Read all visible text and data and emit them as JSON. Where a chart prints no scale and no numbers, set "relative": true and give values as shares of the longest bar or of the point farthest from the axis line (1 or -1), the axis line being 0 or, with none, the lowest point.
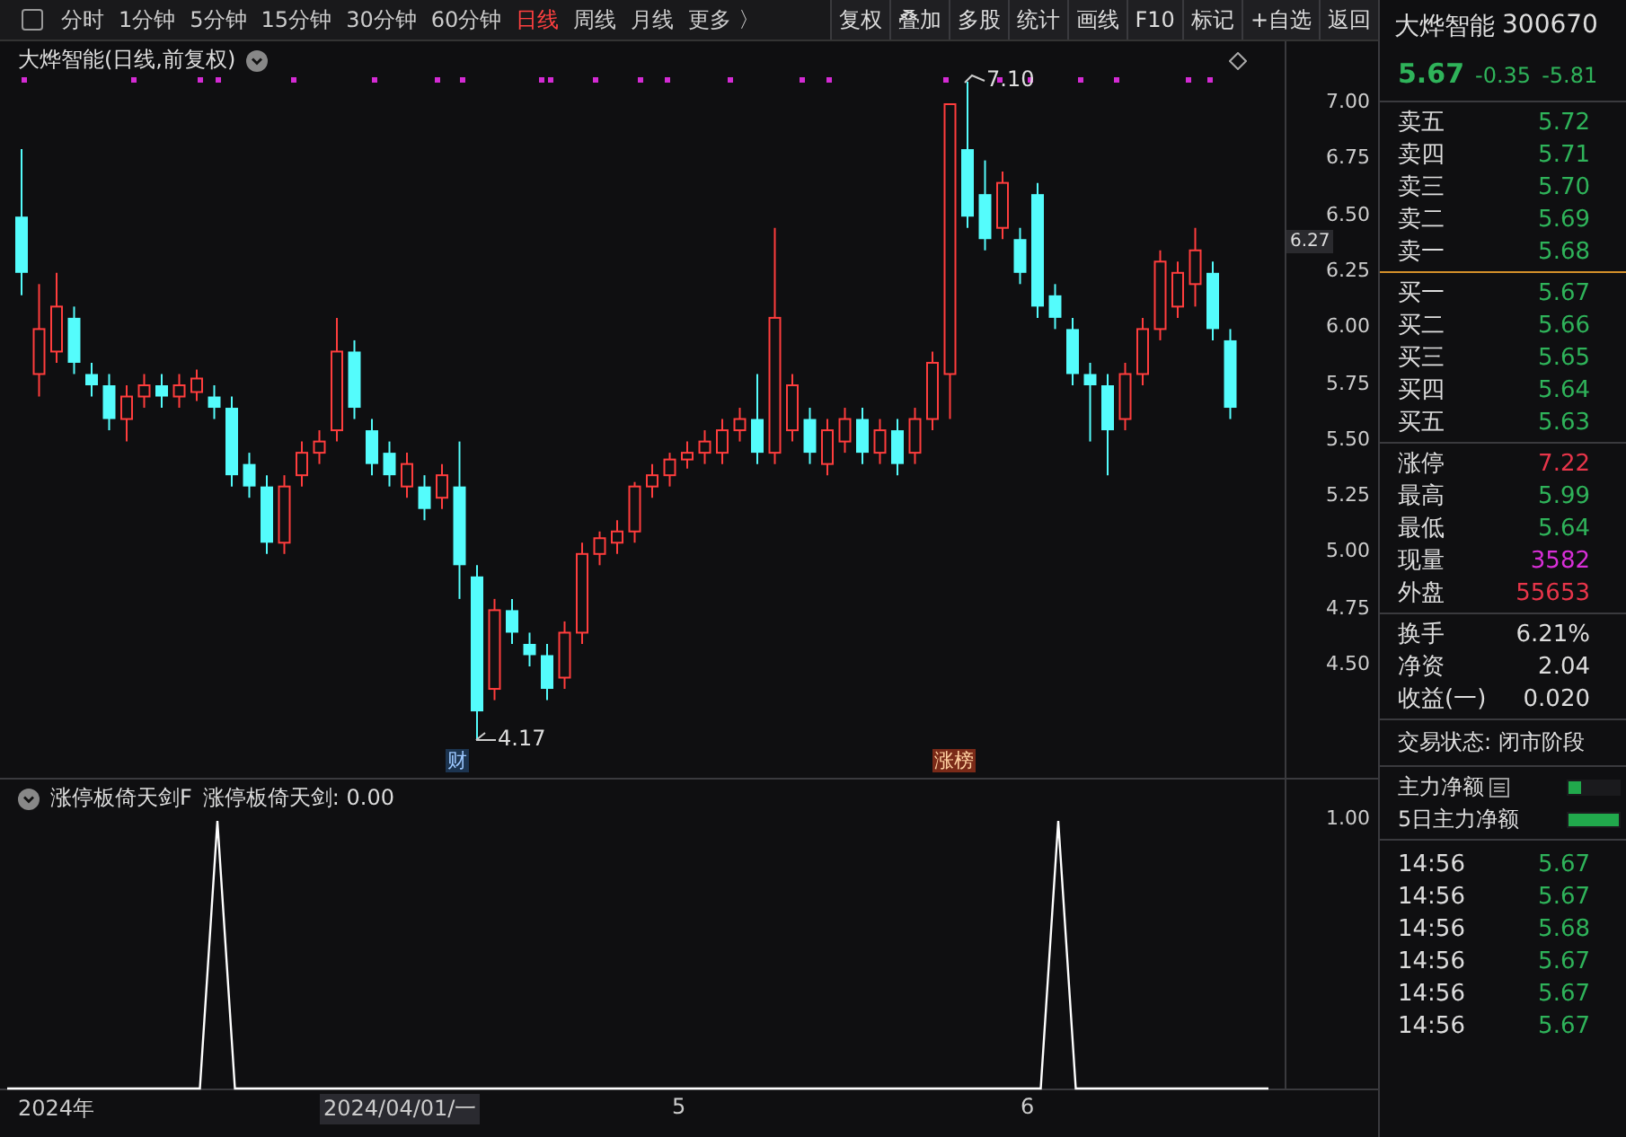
{
  "toolbar": {
    "periods": [
      {
        "label": "分时",
        "selected": false
      },
      {
        "label": "1分钟",
        "selected": false
      },
      {
        "label": "5分钟",
        "selected": false
      },
      {
        "label": "15分钟",
        "selected": false
      },
      {
        "label": "30分钟",
        "selected": false
      },
      {
        "label": "60分钟",
        "selected": false
      },
      {
        "label": "日线",
        "selected": true
      },
      {
        "label": "周线",
        "selected": false
      },
      {
        "label": "月线",
        "selected": false
      },
      {
        "label": "更多 〉",
        "selected": false
      }
    ],
    "actions": [
      "复权",
      "叠加",
      "多股",
      "统计",
      "画线",
      "F10",
      "标记",
      "+自选",
      "返回"
    ]
  },
  "chart": {
    "title": "大烨智能(日线,前复权)",
    "price_ticks": [
      "7.00",
      "6.75",
      "6.50",
      "6.25",
      "6.00",
      "5.75",
      "5.50",
      "5.25",
      "5.00",
      "4.75",
      "4.50"
    ],
    "current_price": "6.27",
    "high_label": "7.10",
    "low_label": "4.17",
    "markers": [
      {
        "label": "财",
        "kind": "finance"
      },
      {
        "label": "涨榜",
        "kind": "limit"
      }
    ]
  },
  "indicator": {
    "name": "涨停板倚天剑F",
    "reading": "涨停板倚天剑: 0.00",
    "top_label": "1.00",
    "chart_data": {
      "type": "line",
      "relative": true,
      "series": [
        {
          "color": "#ffffff",
          "values": [
            0,
            0,
            0,
            0,
            0,
            0,
            0,
            0,
            0,
            0,
            0,
            0,
            1,
            0,
            0,
            0,
            0,
            0,
            0,
            0,
            0,
            0,
            0,
            0,
            0,
            0,
            0,
            0,
            0,
            0,
            0,
            0,
            0,
            0,
            0,
            0,
            0,
            0,
            0,
            0,
            0,
            0,
            0,
            0,
            0,
            0,
            0,
            0,
            0,
            0,
            0,
            0,
            0,
            0,
            0,
            0,
            0,
            0,
            0,
            0,
            1,
            0,
            0,
            0,
            0,
            0,
            0,
            0,
            0,
            0,
            0,
            0,
            0
          ]
        }
      ]
    }
  },
  "x_axis": [
    {
      "label": "2024年",
      "selected": false
    },
    {
      "label": "2024/04/01/一",
      "selected": true
    },
    {
      "label": "5",
      "selected": false
    },
    {
      "label": "6",
      "selected": false
    }
  ],
  "quote": {
    "name": "大烨智能",
    "code": "300670",
    "price": "5.67",
    "change": "-0.35",
    "percent": "-5.81",
    "asks": [
      {
        "label": "卖五",
        "price": "5.72"
      },
      {
        "label": "卖四",
        "price": "5.71"
      },
      {
        "label": "卖三",
        "price": "5.70"
      },
      {
        "label": "卖二",
        "price": "5.69"
      },
      {
        "label": "卖一",
        "price": "5.68"
      }
    ],
    "bids": [
      {
        "label": "买一",
        "price": "5.67"
      },
      {
        "label": "买二",
        "price": "5.66"
      },
      {
        "label": "买三",
        "price": "5.65"
      },
      {
        "label": "买四",
        "price": "5.64"
      },
      {
        "label": "买五",
        "price": "5.63"
      }
    ],
    "stats": [
      {
        "label": "涨停",
        "value": "7.22",
        "color": "#e8354a"
      },
      {
        "label": "最高",
        "value": "5.99",
        "color": "#2fb35a"
      },
      {
        "label": "最低",
        "value": "5.64",
        "color": "#2fb35a"
      },
      {
        "label": "现量",
        "value": "3582",
        "color": "#d82fd8"
      },
      {
        "label": "外盘",
        "value": "55653",
        "color": "#e8354a"
      }
    ],
    "stats2": [
      {
        "label": "换手",
        "value": "6.21%"
      },
      {
        "label": "净资",
        "value": "2.04"
      },
      {
        "label": "收益(一)",
        "value": "0.020"
      }
    ],
    "status": "交易状态: 闭市阶段",
    "flows": [
      {
        "label": "主力净额",
        "icon": true,
        "level": 0.25
      },
      {
        "label": "5日主力净额",
        "icon": false,
        "level": 1
      }
    ],
    "ticks": [
      {
        "time": "14:56",
        "price": "5.67"
      },
      {
        "time": "14:56",
        "price": "5.67"
      },
      {
        "time": "14:56",
        "price": "5.68"
      },
      {
        "time": "14:56",
        "price": "5.67"
      },
      {
        "time": "14:56",
        "price": "5.67"
      },
      {
        "time": "14:56",
        "price": "5.67"
      }
    ]
  }
}
